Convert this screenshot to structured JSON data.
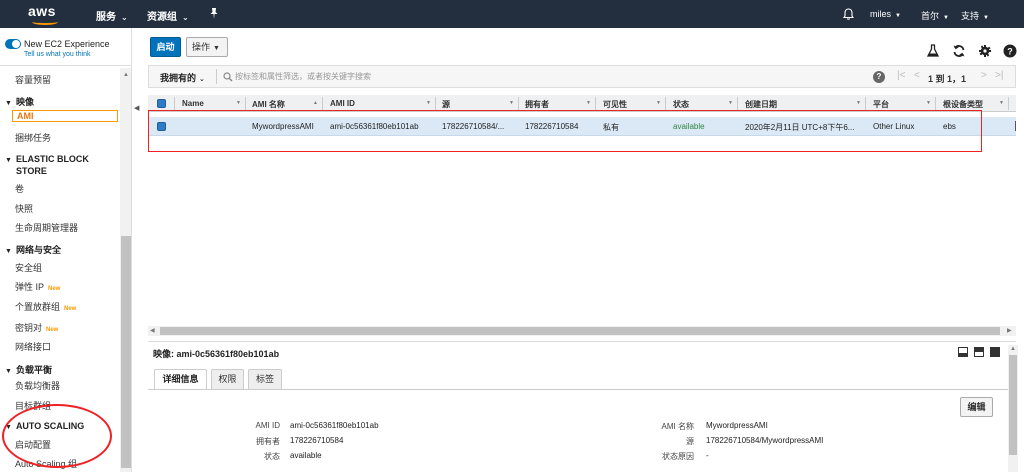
{
  "topnav": {
    "logo": "aws",
    "services": "服务",
    "resource_groups": "资源组",
    "user": "miles",
    "region": "首尔",
    "support": "支持"
  },
  "sidebar": {
    "experience_label": "New EC2 Experience",
    "experience_link": "Tell us what you think",
    "items": [
      {
        "label": "容量预留",
        "kind": "link"
      },
      {
        "label": "映像",
        "kind": "header"
      },
      {
        "label": "AMI",
        "kind": "active"
      },
      {
        "label": "捆绑任务",
        "kind": "link"
      },
      {
        "label": "ELASTIC BLOCK",
        "kind": "header"
      },
      {
        "label": "STORE",
        "kind": "header-cont"
      },
      {
        "label": "卷",
        "kind": "link"
      },
      {
        "label": "快照",
        "kind": "link"
      },
      {
        "label": "生命周期管理器",
        "kind": "link"
      },
      {
        "label": "网络与安全",
        "kind": "header"
      },
      {
        "label": "安全组",
        "kind": "link"
      },
      {
        "label": "弹性 IP",
        "kind": "link",
        "badge": "New"
      },
      {
        "label": "个置放群组",
        "kind": "link",
        "badge": "New"
      },
      {
        "label": "密钥对",
        "kind": "link",
        "badge": "New"
      },
      {
        "label": "网络接口",
        "kind": "link"
      },
      {
        "label": "负载平衡",
        "kind": "header"
      },
      {
        "label": "负载均衡器",
        "kind": "link"
      },
      {
        "label": "目标群组",
        "kind": "link"
      },
      {
        "label": "AUTO SCALING",
        "kind": "header"
      },
      {
        "label": "启动配置",
        "kind": "link"
      },
      {
        "label": "Auto Scaling 组",
        "kind": "link"
      }
    ]
  },
  "toolbar": {
    "launch": "启动",
    "actions": "操作"
  },
  "filter": {
    "owner_select": "我拥有的",
    "placeholder": "按标签和属性筛选，或者按关键字搜索",
    "pagination": "1 到 1，1"
  },
  "table": {
    "columns": [
      "Name",
      "AMI 名称",
      "AMI ID",
      "源",
      "拥有者",
      "可见性",
      "状态",
      "创建日期",
      "平台",
      "根设备类型"
    ],
    "rows": [
      {
        "name": "",
        "ami_name": "MywordpressAMI",
        "ami_id": "ami-0c56361f80eb101ab",
        "source": "178226710584/...",
        "owner": "178226710584",
        "visibility": "私有",
        "status": "available",
        "created": "2020年2月11日 UTC+8下午6...",
        "platform": "Other Linux",
        "root_device": "ebs"
      }
    ]
  },
  "detail": {
    "title": "映像: ami-0c56361f80eb101ab",
    "tabs": [
      "详细信息",
      "权限",
      "标签"
    ],
    "edit": "编辑",
    "left": [
      {
        "label": "AMI ID",
        "value": "ami-0c56361f80eb101ab"
      },
      {
        "label": "拥有者",
        "value": "178226710584"
      },
      {
        "label": "状态",
        "value": "available"
      }
    ],
    "right": [
      {
        "label": "AMI 名称",
        "value": "MywordpressAMI"
      },
      {
        "label": "源",
        "value": "178226710584/MywordpressAMI"
      },
      {
        "label": "状态原因",
        "value": "-"
      }
    ]
  },
  "colors": {
    "nav_bg": "#232f3e",
    "accent_blue": "#0073bb",
    "accent_orange": "#ff9900",
    "status_green": "#2e8540",
    "annotation_red": "#ee2222"
  }
}
